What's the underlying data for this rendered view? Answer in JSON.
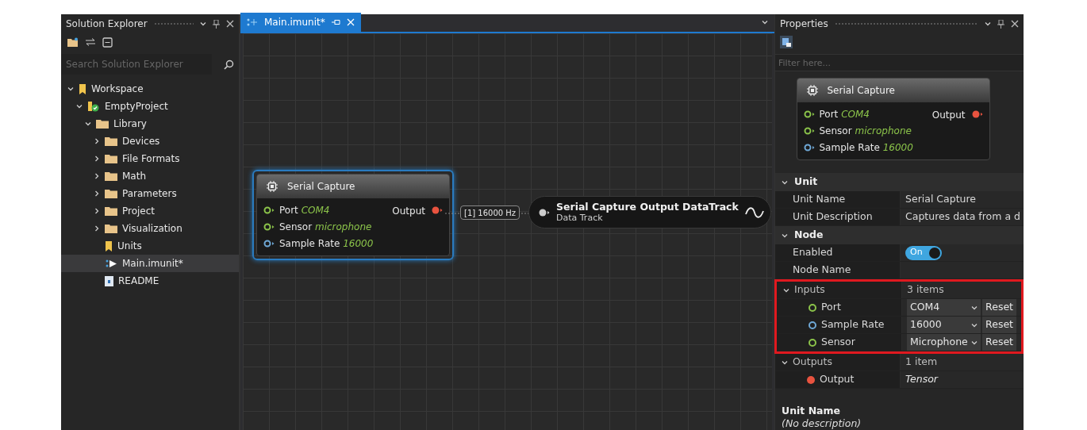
{
  "solution_explorer": {
    "title": "Solution Explorer",
    "search": {
      "placeholder": "Search Solution Explorer"
    },
    "tree": [
      {
        "label": "Workspace",
        "kind": "workspace",
        "expanded": true,
        "selected": false,
        "children": [
          {
            "label": "EmptyProject",
            "kind": "project",
            "expanded": true,
            "selected": false,
            "children": [
              {
                "label": "Library",
                "kind": "folder",
                "expanded": true,
                "selected": false,
                "children": [
                  {
                    "label": "Devices",
                    "kind": "folder",
                    "expanded": false,
                    "selected": false
                  },
                  {
                    "label": "File Formats",
                    "kind": "folder",
                    "expanded": false,
                    "selected": false
                  },
                  {
                    "label": "Math",
                    "kind": "folder",
                    "expanded": false,
                    "selected": false
                  },
                  {
                    "label": "Parameters",
                    "kind": "folder",
                    "expanded": false,
                    "selected": false
                  },
                  {
                    "label": "Project",
                    "kind": "folder",
                    "expanded": false,
                    "selected": false
                  },
                  {
                    "label": "Visualization",
                    "kind": "folder",
                    "expanded": false,
                    "selected": false
                  },
                  {
                    "label": "Units",
                    "kind": "units",
                    "selected": false
                  },
                  {
                    "label": "Main.imunit*",
                    "kind": "unit",
                    "selected": true
                  },
                  {
                    "label": "README",
                    "kind": "readme",
                    "selected": false
                  }
                ]
              }
            ]
          }
        ]
      }
    ]
  },
  "editor": {
    "tabs": [
      {
        "label": "Main.imunit*",
        "selected": true
      }
    ],
    "node": {
      "title": "Serial Capture",
      "inputs": [
        {
          "name": "Port",
          "value": "COM4",
          "color": "#8bc34a"
        },
        {
          "name": "Sensor",
          "value": "microphone",
          "color": "#8bc34a"
        },
        {
          "name": "Sample Rate",
          "value": "16000",
          "color": "#6fa8d6"
        }
      ],
      "output": "Output"
    },
    "link_label": "[1] 16000 Hz",
    "track": {
      "title": "Serial Capture Output DataTrack",
      "subtitle": "Data Track"
    }
  },
  "properties": {
    "title": "Properties",
    "filter": {
      "placeholder": "Filter here..."
    },
    "preview": {
      "title": "Serial Capture",
      "inputs": [
        {
          "name": "Port",
          "value": "COM4",
          "color": "#8bc34a"
        },
        {
          "name": "Sensor",
          "value": "microphone",
          "color": "#8bc34a"
        },
        {
          "name": "Sample Rate",
          "value": "16000",
          "color": "#6fa8d6"
        }
      ],
      "output": "Output"
    },
    "sections": [
      {
        "title": "Unit",
        "expanded": true,
        "rows": [
          {
            "kind": "text",
            "label": "Unit Name",
            "value": "Serial Capture"
          },
          {
            "kind": "text",
            "label": "Unit Description",
            "value": "Captures data from a d"
          }
        ]
      },
      {
        "title": "Node",
        "expanded": true,
        "rows": [
          {
            "kind": "toggle",
            "label": "Enabled",
            "on": true,
            "value": "On"
          },
          {
            "kind": "text",
            "label": "Node Name"
          },
          {
            "kind": "group",
            "label": "Inputs",
            "value": "3 items",
            "expanded": true,
            "highlighted": true,
            "children": [
              {
                "kind": "select",
                "label": "Port",
                "color": "#8bc34a",
                "value": "COM4",
                "button": "Reset"
              },
              {
                "kind": "select",
                "label": "Sample Rate",
                "color": "#6fa8d6",
                "value": "16000",
                "button": "Reset"
              },
              {
                "kind": "select",
                "label": "Sensor",
                "color": "#8bc34a",
                "value": "Microphone",
                "button": "Reset"
              }
            ]
          },
          {
            "kind": "group",
            "label": "Outputs",
            "value": "1 item",
            "expanded": true,
            "highlighted": false,
            "children": [
              {
                "kind": "type",
                "label": "Output",
                "color": "#e8533f",
                "value": "Tensor"
              }
            ]
          }
        ]
      }
    ],
    "description": {
      "title": "Unit Name",
      "text": "(No description)"
    }
  }
}
